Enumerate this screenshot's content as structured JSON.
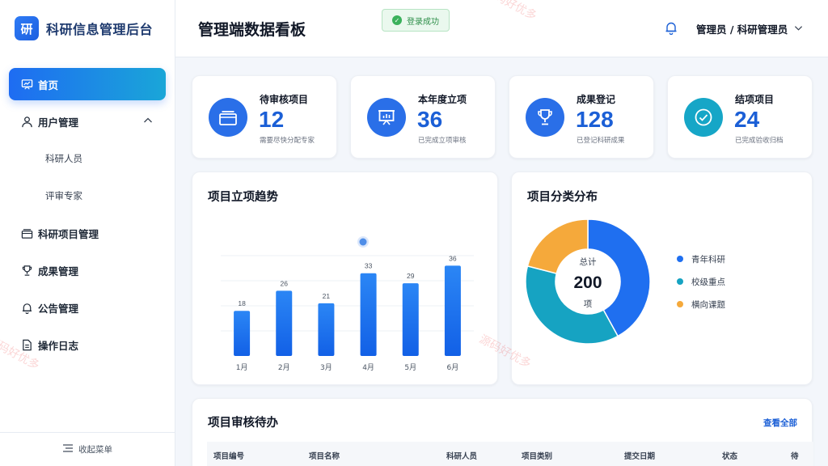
{
  "app": {
    "logo_char": "研",
    "title": "科研信息管理后台"
  },
  "sidebar": {
    "items": [
      {
        "label": "首页",
        "icon": "chart-board-icon",
        "active": true
      },
      {
        "label": "用户管理",
        "icon": "user-icon",
        "expanded": true
      },
      {
        "label": "科研人员",
        "sub": true
      },
      {
        "label": "评审专家",
        "sub": true
      },
      {
        "label": "科研项目管理",
        "icon": "folder-stack-icon"
      },
      {
        "label": "成果管理",
        "icon": "trophy-icon"
      },
      {
        "label": "公告管理",
        "icon": "bell-icon"
      },
      {
        "label": "操作日志",
        "icon": "document-icon"
      }
    ],
    "collapse_label": "收起菜单"
  },
  "header": {
    "title": "管理端数据看板",
    "toast": "登录成功",
    "user": "管理员 / 科研管理员"
  },
  "stats": [
    {
      "label": "待审核项目",
      "value": "12",
      "desc": "需要尽快分配专家",
      "color": "#2a6fe8",
      "icon": "folder-icon"
    },
    {
      "label": "本年度立项",
      "value": "36",
      "desc": "已完成立项审核",
      "color": "#2a6fe8",
      "icon": "presentation-icon"
    },
    {
      "label": "成果登记",
      "value": "128",
      "desc": "已登记科研成果",
      "color": "#2a6fe8",
      "icon": "trophy-icon"
    },
    {
      "label": "结项项目",
      "value": "24",
      "desc": "已完成验收归档",
      "color": "#16a6c7",
      "icon": "check-circle-icon"
    }
  ],
  "trend": {
    "title": "项目立项趋势"
  },
  "pie": {
    "title": "项目分类分布",
    "center_label": "总计",
    "center_value": "200",
    "center_unit": "项"
  },
  "table": {
    "title": "项目审核待办",
    "view_all": "查看全部",
    "columns": [
      "项目编号",
      "项目名称",
      "科研人员",
      "项目类别",
      "提交日期",
      "状态",
      "待"
    ]
  },
  "watermarks": [
    "源码好优多",
    "源码好优多",
    "源码好优多"
  ],
  "chart_data": [
    {
      "type": "bar",
      "categories": [
        "1月",
        "2月",
        "3月",
        "4月",
        "5月",
        "6月"
      ],
      "values": [
        18,
        26,
        21,
        33,
        29,
        36
      ],
      "color": "#1f6ff0"
    },
    {
      "type": "pie",
      "labels": [
        "青年科研",
        "校级重点",
        "横向课题"
      ],
      "values": [
        84,
        74,
        42
      ],
      "colors": [
        "#1f6ff0",
        "#16a3c2",
        "#f5a93b"
      ]
    }
  ]
}
